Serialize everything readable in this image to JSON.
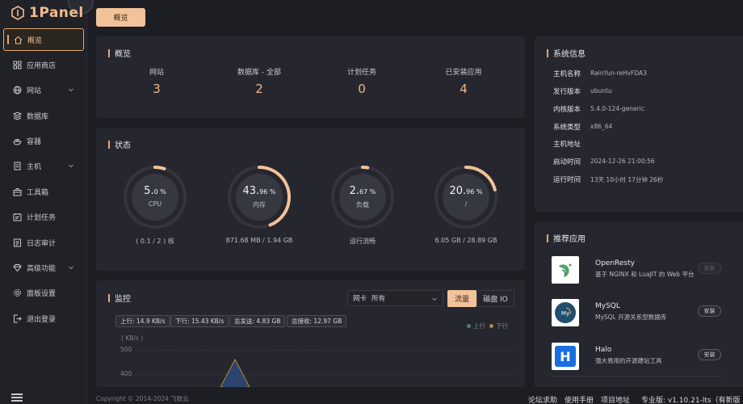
{
  "app": {
    "logo_text": "1Panel"
  },
  "top_tab": {
    "label": "概览"
  },
  "sidebar": {
    "items": [
      {
        "label": "概览",
        "icon": "home-icon",
        "active": true,
        "expand": false
      },
      {
        "label": "应用商店",
        "icon": "grid-icon",
        "active": false,
        "expand": false
      },
      {
        "label": "网站",
        "icon": "globe-icon",
        "active": false,
        "expand": true
      },
      {
        "label": "数据库",
        "icon": "database-icon",
        "active": false,
        "expand": false
      },
      {
        "label": "容器",
        "icon": "docker-icon",
        "active": false,
        "expand": false
      },
      {
        "label": "主机",
        "icon": "server-icon",
        "active": false,
        "expand": true
      },
      {
        "label": "工具箱",
        "icon": "toolbox-icon",
        "active": false,
        "expand": false
      },
      {
        "label": "计划任务",
        "icon": "calendar-icon",
        "active": false,
        "expand": false
      },
      {
        "label": "日志审计",
        "icon": "log-icon",
        "active": false,
        "expand": false
      },
      {
        "label": "高级功能",
        "icon": "diamond-icon",
        "active": false,
        "expand": true
      },
      {
        "label": "面板设置",
        "icon": "gear-icon",
        "active": false,
        "expand": false
      },
      {
        "label": "退出登录",
        "icon": "logout-icon",
        "active": false,
        "expand": false
      }
    ]
  },
  "overview": {
    "title": "概览",
    "items": [
      {
        "label": "网站",
        "value": "3"
      },
      {
        "label": "数据库 - 全部",
        "value": "2"
      },
      {
        "label": "计划任务",
        "value": "0"
      },
      {
        "label": "已安装应用",
        "value": "4"
      }
    ]
  },
  "status": {
    "title": "状态",
    "gauges": [
      {
        "int": "5.",
        "frac": "0 %",
        "name": "CPU",
        "sub": "( 0.1 / 2 ) 核",
        "percent": 5.0
      },
      {
        "int": "43.",
        "frac": "96 %",
        "name": "内存",
        "sub": "871.68 MB / 1.94 GB",
        "percent": 43.96
      },
      {
        "int": "2.",
        "frac": "67 %",
        "name": "负载",
        "sub": "运行流畅",
        "percent": 2.67
      },
      {
        "int": "20.",
        "frac": "96 %",
        "name": "/",
        "sub": "6.05 GB / 28.89 GB",
        "percent": 20.96
      }
    ]
  },
  "monitor": {
    "title": "监控",
    "select_label": "网卡",
    "select_value": "所有",
    "seg_on": "流量",
    "seg_off": "磁盘 IO",
    "tags": [
      "上行: 14.9 KB/s",
      "下行: 15.43 KB/s",
      "总发送: 4.83 GB",
      "总接收: 12.97 GB"
    ],
    "legend": [
      {
        "label": "上行",
        "color": "#3f8b6b"
      },
      {
        "label": "下行",
        "color": "#b08a3c"
      }
    ],
    "unit": "( KB/s )",
    "yticks": [
      "500",
      "400"
    ]
  },
  "chart_data": {
    "type": "area",
    "ylabel": "( KB/s )",
    "yticks": [
      500,
      400
    ],
    "series": [
      {
        "name": "上行",
        "peak": 460
      },
      {
        "name": "下行",
        "peak": 440
      }
    ]
  },
  "sysinfo": {
    "title": "系统信息",
    "rows": [
      {
        "key": "主机名称",
        "val": "RainYun-reHvFDA3"
      },
      {
        "key": "发行版本",
        "val": "ubuntu"
      },
      {
        "key": "内核版本",
        "val": "5.4.0-124-generic"
      },
      {
        "key": "系统类型",
        "val": "x86_64"
      },
      {
        "key": "主机地址",
        "val": ""
      },
      {
        "key": "启动时间",
        "val": "2024-12-26 21:00:56"
      },
      {
        "key": "运行时间",
        "val": "13天 10小时 17分钟 26秒"
      }
    ]
  },
  "recommend": {
    "title": "推荐应用",
    "apps": [
      {
        "name": "OpenResty",
        "desc": "基于 NGINX 和 LuaJIT 的 Web 平台",
        "button": "安装",
        "disabled": true
      },
      {
        "name": "MySQL",
        "desc": "MySQL 开源关系型数据库",
        "button": "安装",
        "disabled": false
      },
      {
        "name": "Halo",
        "desc": "强大易用的开源建站工具",
        "button": "安装",
        "disabled": false
      }
    ]
  },
  "footer": {
    "copyright": "Copyright © 2014-2024 飞致云",
    "links": [
      "论坛求助",
      "使用手册",
      "项目地址"
    ],
    "version": "专业版: v1.10.21-lts（有新版"
  },
  "colors": {
    "accent": "#f0b886",
    "background": "#1d1e24",
    "card": "#26272e"
  }
}
